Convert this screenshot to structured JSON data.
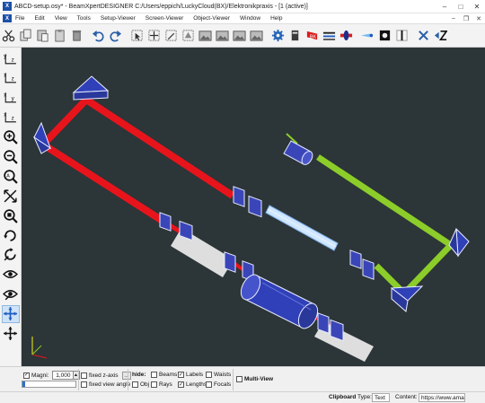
{
  "window": {
    "title": "ABCD-setup.osy* - BeamXpertDESIGNER C:/Users/eppich/LuckyCloud(BX)/Elektronikpraxis - [1 (active)]",
    "app_icon": "X",
    "minimize": "–",
    "maximize": "□",
    "close": "✕"
  },
  "menubar": {
    "logo": "X",
    "items": [
      "File",
      "Edit",
      "View",
      "Tools",
      "Setup-Viewer",
      "Screen-Viewer",
      "Object-Viewer",
      "Window",
      "Help"
    ],
    "window_controls": [
      "–",
      "❐",
      "✕"
    ]
  },
  "toolbar": {
    "icons": [
      "scissors-icon",
      "copy-icon",
      "paste-icon",
      "clipboard-icon",
      "trash-icon",
      "undo-icon",
      "redo-icon",
      "pick-icon",
      "move-icon",
      "edit-object-icon",
      "clone-icon",
      "image-icon",
      "image-2-icon",
      "image-3-icon",
      "image-4-icon",
      "settings-icon",
      "ruler-icon",
      "marker-icon",
      "lens-sheet-icon",
      "lens-flip-icon",
      "beam-icon",
      "black-box-icon",
      "slit-icon",
      "zoom-x-icon",
      "z-axis-icon"
    ]
  },
  "sidebar": {
    "icons": [
      "view-xz-icon",
      "view-yz-icon",
      "view-zx-icon",
      "view-zy-icon",
      "zoom-in-icon",
      "zoom-out-icon",
      "zoom-fit-icon",
      "fit-all-icon",
      "zoom-area-icon",
      "rotate-icon",
      "reset-view-icon",
      "eye-icon",
      "eye-2-icon",
      "pan-icon",
      "move-all-icon"
    ],
    "active_index": 13
  },
  "viewport": {
    "background": "#2c3538",
    "beam_red": "#e8141c",
    "beam_green": "#8ccd2a",
    "beam_blue": "#d9ecff",
    "optic_fill": "#3040b8"
  },
  "controls": {
    "magni_label": "Magni:",
    "magni_checked": true,
    "magni_value": "1,000",
    "magni_slider_fraction": 0.05,
    "fixed_z_axis": "fixed z-axis",
    "fixed_z_axis_checked": false,
    "fixed_view_angle": "fixed view angle",
    "fixed_view_angle_checked": false,
    "more_button": "...",
    "hide_label": "hide:",
    "hide_options": [
      {
        "label": "Beams",
        "checked": false
      },
      {
        "label": "Labels",
        "checked": true
      },
      {
        "label": "Waists",
        "checked": false
      },
      {
        "label": "Obj",
        "checked": false
      },
      {
        "label": "Rays",
        "checked": false
      },
      {
        "label": "Lengths",
        "checked": true
      },
      {
        "label": "Focals",
        "checked": false
      }
    ],
    "multi_view": "Multi-View",
    "multi_view_checked": false
  },
  "statusbar": {
    "clipboard_label": "Clipboard",
    "type_label": "Type:",
    "type_value": "Text",
    "content_label": "Content:",
    "content_value": "https://www.ama..."
  }
}
